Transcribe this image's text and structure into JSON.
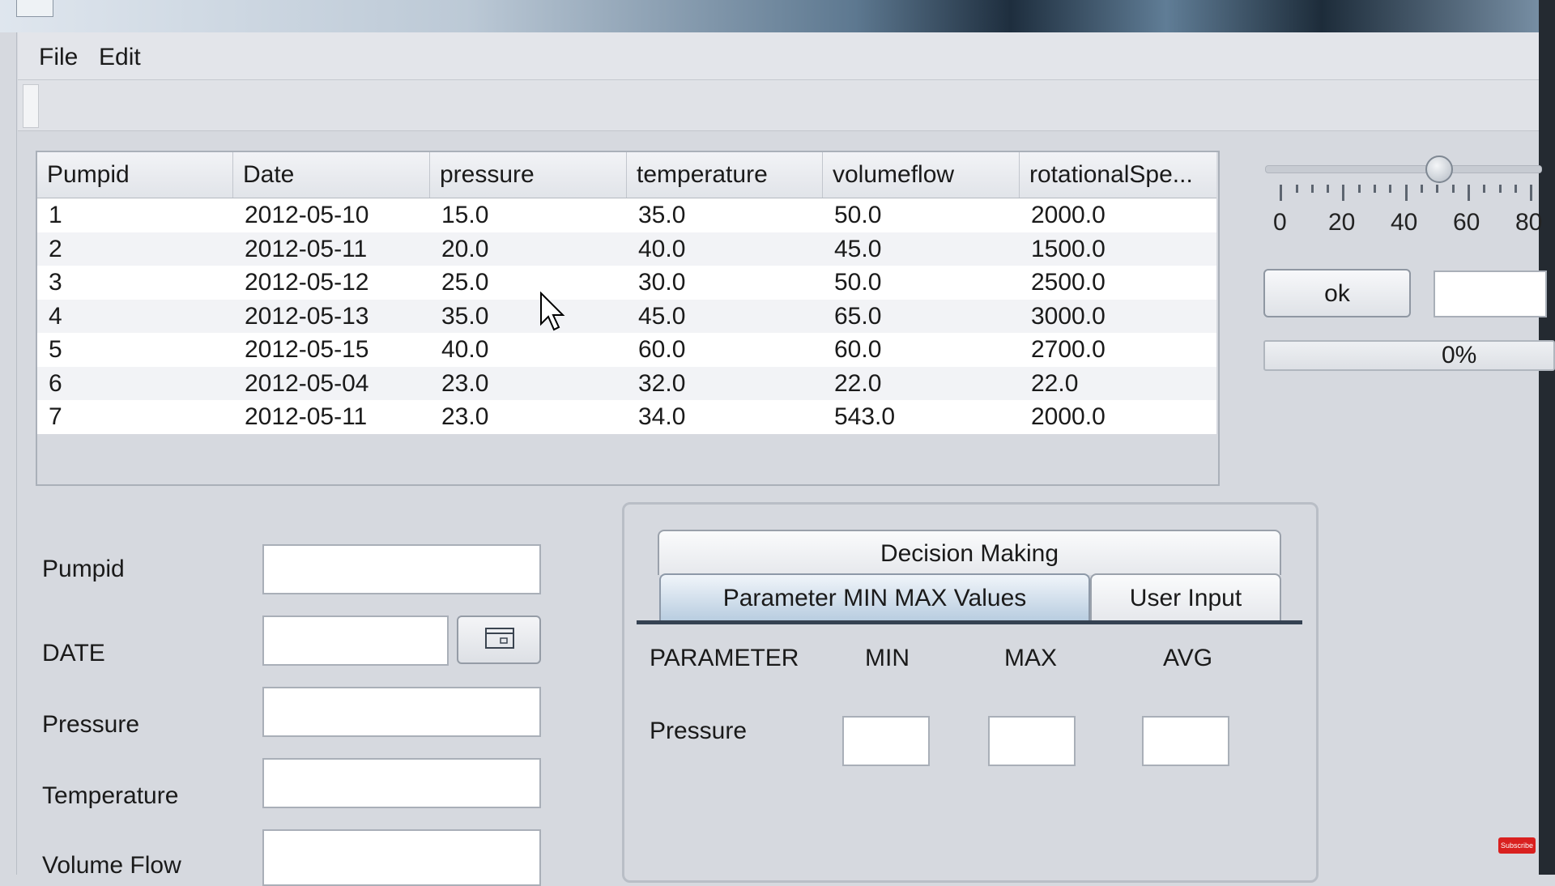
{
  "menu": {
    "items": [
      "File",
      "Edit"
    ]
  },
  "table": {
    "columns": [
      "Pumpid",
      "Date",
      "pressure",
      "temperature",
      "volumeflow",
      "rotationalSpe..."
    ],
    "rows": [
      [
        "1",
        "2012-05-10",
        "15.0",
        "35.0",
        "50.0",
        "2000.0"
      ],
      [
        "2",
        "2012-05-11",
        "20.0",
        "40.0",
        "45.0",
        "1500.0"
      ],
      [
        "3",
        "2012-05-12",
        "25.0",
        "30.0",
        "50.0",
        "2500.0"
      ],
      [
        "4",
        "2012-05-13",
        "35.0",
        "45.0",
        "65.0",
        "3000.0"
      ],
      [
        "5",
        "2012-05-15",
        "40.0",
        "60.0",
        "60.0",
        "2700.0"
      ],
      [
        "6",
        "2012-05-04",
        "23.0",
        "32.0",
        "22.0",
        "22.0"
      ],
      [
        "7",
        "2012-05-11",
        "23.0",
        "34.0",
        "543.0",
        "2000.0"
      ]
    ]
  },
  "slider": {
    "tick_labels": [
      "0",
      "20",
      "40",
      "60",
      "80"
    ],
    "value": 50
  },
  "ok_button": "ok",
  "progress": {
    "text": "0%",
    "value": 0
  },
  "form": {
    "pumpid_label": "Pumpid",
    "date_label": "DATE",
    "pressure_label": "Pressure",
    "temperature_label": "Temperature",
    "volume_flow_label": "Volume Flow"
  },
  "tabs": {
    "decision_making": "Decision Making",
    "param_minmax": "Parameter MIN MAX Values",
    "user_input": "User Input"
  },
  "param_panel": {
    "headers": {
      "parameter": "PARAMETER",
      "min": "MIN",
      "max": "MAX",
      "avg": "AVG"
    },
    "row_label": "Pressure"
  },
  "subscribe_badge": "Subscribe",
  "colors": {
    "tab_active": "#b9cde0",
    "background": "#d6d9df",
    "badge": "#d9201f"
  }
}
